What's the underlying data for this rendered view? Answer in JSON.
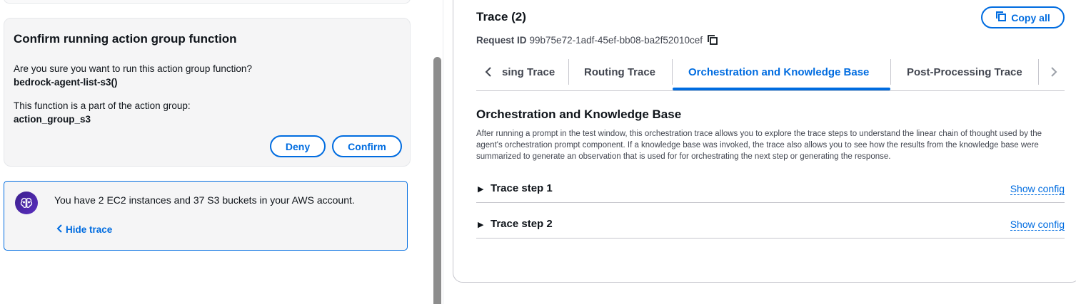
{
  "confirm": {
    "title": "Confirm running action group function",
    "question": "Are you sure you want to run this action group function?",
    "function_name": "bedrock-agent-list-s3()",
    "part_of": "This function is a part of the action group:",
    "action_group": "action_group_s3",
    "deny_label": "Deny",
    "confirm_label": "Confirm"
  },
  "message": {
    "text": "You have 2 EC2 instances and 37 S3 buckets in your AWS account.",
    "hide_trace_label": "Hide trace"
  },
  "trace": {
    "title": "Trace (2)",
    "copy_all_label": "Copy all",
    "request_id_label": "Request ID",
    "request_id": "99b75e72-1adf-45ef-bb08-ba2f52010cef",
    "tabs": [
      {
        "label": "sing Trace"
      },
      {
        "label": "Routing Trace"
      },
      {
        "label": "Orchestration and Knowledge Base"
      },
      {
        "label": "Post-Processing Trace"
      }
    ],
    "active_tab": "Orchestration and Knowledge Base",
    "section_title": "Orchestration and Knowledge Base",
    "section_description": "After running a prompt in the test window, this orchestration trace allows you to explore the trace steps to understand the linear chain of thought used by the agent's orchestration prompt component. If a knowledge base was invoked, the trace also allows you to see how the results from the knowledge base were summarized to generate an observation that is used for for orchestrating the next step or generating the response.",
    "steps": [
      {
        "label": "Trace step 1",
        "action": "Show config"
      },
      {
        "label": "Trace step 2",
        "action": "Show config"
      }
    ]
  },
  "colors": {
    "accent": "#006ce0",
    "card_bg": "#f5f5f6",
    "border": "#c6c6cd",
    "avatar": "#4a25a8"
  }
}
